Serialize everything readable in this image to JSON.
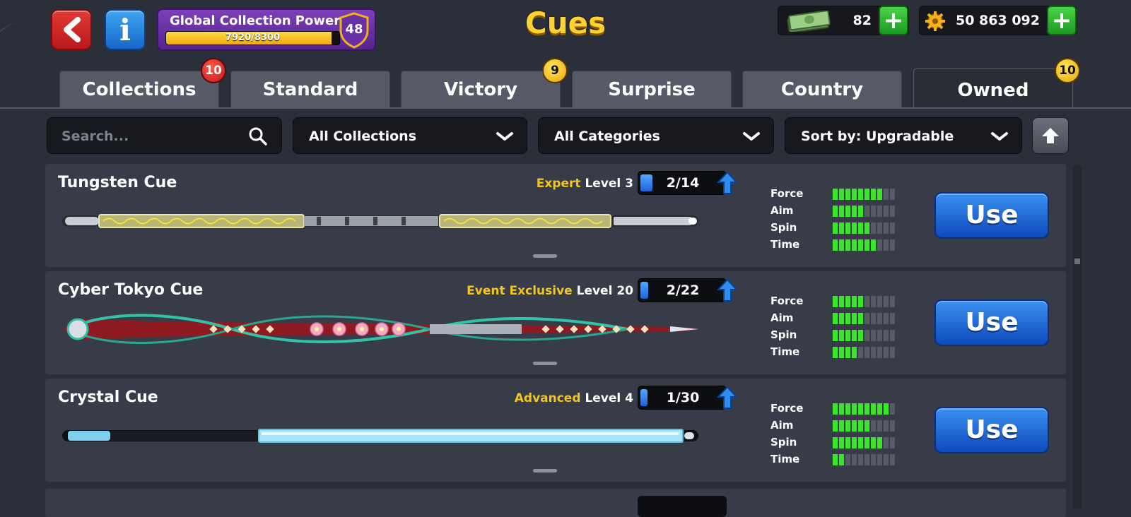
{
  "header": {
    "title": "Cues",
    "global_collection_power": {
      "label": "Global Collection Power",
      "progress_text": "7920/8300",
      "current": 7920,
      "max": 8300,
      "level": "48"
    },
    "cash": {
      "value": "82",
      "icon": "cash-icon"
    },
    "coins": {
      "value": "50 863 092",
      "icon": "coin-icon"
    }
  },
  "tabs": [
    {
      "label": "Collections",
      "badge": "10",
      "badge_color": "red",
      "active": false
    },
    {
      "label": "Standard",
      "badge": "",
      "active": false
    },
    {
      "label": "Victory",
      "badge": "9",
      "badge_color": "gold",
      "active": false
    },
    {
      "label": "Surprise",
      "badge": "",
      "active": false
    },
    {
      "label": "Country",
      "badge": "",
      "active": false
    },
    {
      "label": "Owned",
      "badge": "10",
      "badge_color": "gold",
      "active": true
    }
  ],
  "filters": {
    "search_placeholder": "Search...",
    "collection": "All Collections",
    "category": "All Categories",
    "sort": "Sort by: Upgradable"
  },
  "stat_labels": [
    "Force",
    "Aim",
    "Spin",
    "Time"
  ],
  "cues": [
    {
      "name": "Tungsten Cue",
      "rarity": "Expert",
      "level": "Level 3",
      "progress": "2/14",
      "progress_fraction": 0.14,
      "stats": [
        8,
        5,
        6,
        7
      ],
      "stat_max": 10,
      "button": "Use",
      "style": "tungsten"
    },
    {
      "name": "Cyber Tokyo Cue",
      "rarity": "Event Exclusive",
      "level": "Level 20",
      "progress": "2/22",
      "progress_fraction": 0.09,
      "stats": [
        5,
        5,
        5,
        4
      ],
      "stat_max": 10,
      "button": "Use",
      "style": "tokyo"
    },
    {
      "name": "Crystal Cue",
      "rarity": "Advanced",
      "level": "Level 4",
      "progress": "1/30",
      "progress_fraction": 0.03,
      "stats": [
        9,
        6,
        8,
        2
      ],
      "stat_max": 10,
      "button": "Use",
      "style": "crystal"
    }
  ],
  "colors": {
    "background": "#2b2f3a",
    "card": "#383c48",
    "rarity_text": "#f2c521",
    "stat_on": "#39e52b",
    "title": "#ffd233"
  }
}
